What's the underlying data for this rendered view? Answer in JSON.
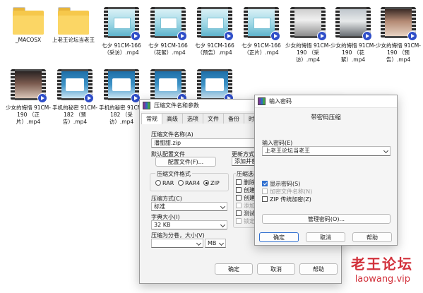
{
  "files": [
    {
      "label": "_MACOSX",
      "kind": "folder"
    },
    {
      "label": "上老王论坛当老王",
      "kind": "folder"
    },
    {
      "label": "七夕 91CM-166 （采访）.mp4",
      "kind": "video",
      "thumb": "teal"
    },
    {
      "label": "七夕 91CM-166 （花絮）.mp4",
      "kind": "video",
      "thumb": "teal"
    },
    {
      "label": "七夕 91CM-166 （预告）.mp4",
      "kind": "video",
      "thumb": "teal"
    },
    {
      "label": "七夕 91CM-166 （正片）.mp4",
      "kind": "video",
      "thumb": "teal"
    },
    {
      "label": "少女的悔悟 91CM-190 （采访）.mp4",
      "kind": "video",
      "thumb": "photo1"
    },
    {
      "label": "少女的悔悟 91CM-190 （花絮）.mp4",
      "kind": "video",
      "thumb": "photo2"
    },
    {
      "label": "少女的悔悟 91CM-190 （预告）.mp4",
      "kind": "video",
      "thumb": "photo3"
    },
    {
      "label": "少女的悔悟 91CM-190 （正片）.mp4",
      "kind": "video",
      "thumb": "photo4"
    },
    {
      "label": "手机的秘密 91CM-182 （预告）.mp4",
      "kind": "video",
      "thumb": "blue"
    },
    {
      "label": "手机的秘密 91CM-182 （采访）.mp4",
      "kind": "video",
      "thumb": "blue"
    },
    {
      "label": "",
      "kind": "video",
      "thumb": "blue"
    },
    {
      "label": "",
      "kind": "video",
      "thumb": "blue"
    }
  ],
  "archive_dialog": {
    "title": "压缩文件名和参数",
    "tabs": [
      "常规",
      "高级",
      "选项",
      "文件",
      "备份",
      "时间"
    ],
    "filename_label": "压缩文件名称(A)",
    "filename_value": "潘甜甜.zip",
    "default_profile_label": "默认配置文件",
    "profile_button": "配置文件(F)...",
    "update_mode_label": "更新方式",
    "update_mode_value": "添加并替",
    "format_label": "压缩文件格式",
    "formats": [
      "RAR",
      "RAR4",
      "ZIP"
    ],
    "selected_format": "ZIP",
    "options_label": "压缩选项",
    "options": [
      "删除",
      "创建",
      "创建",
      "添加",
      "测试",
      "锁定"
    ],
    "method_label": "压缩方式(C)",
    "method_value": "标准",
    "dict_label": "字典大小(I)",
    "dict_value": "32 KB",
    "split_label": "压缩为分卷，大小(V)",
    "split_value": "",
    "split_unit": "MB",
    "ok": "确定",
    "cancel": "取消",
    "help": "帮助"
  },
  "password_dialog": {
    "title": "输入密码",
    "heading": "带密码压缩",
    "input_label": "输入密码(E)",
    "password_value": "上老王论坛当老王",
    "show_password": "显示密码(S)",
    "encrypt_names": "加密文件名称(N)",
    "zip_legacy": "ZIP 传统加密(Z)",
    "manage_button": "管理密码(O)...",
    "ok": "确定",
    "cancel": "取消",
    "help": "帮助"
  },
  "watermark": {
    "text": "老王论坛",
    "url": "laowang.vip",
    "color": "#d2323c"
  }
}
